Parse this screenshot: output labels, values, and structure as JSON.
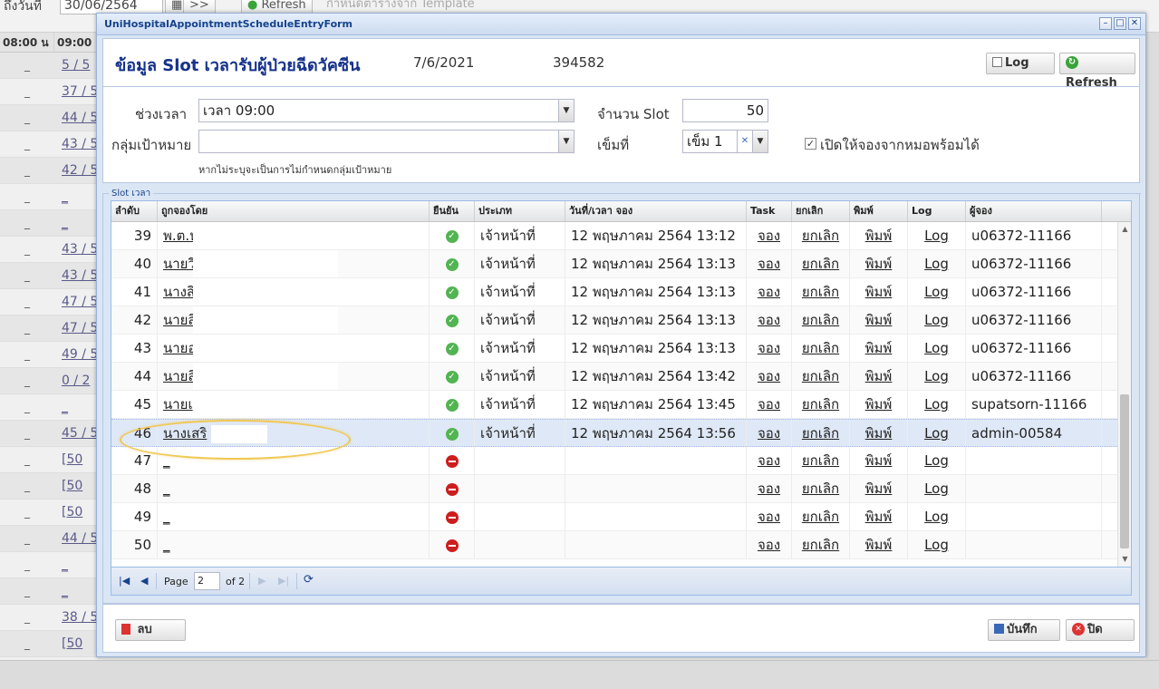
{
  "background": {
    "date_label": "ถึงวันที่",
    "date_value": "30/06/2564",
    "nav_btn": ">>",
    "refresh_btn": "Refresh",
    "template_btn": "กำหนดตารางจาก Template",
    "col_headers": [
      "08:00 น",
      "09:00"
    ],
    "rows": [
      {
        "c1": "_",
        "c2": "5 / 5"
      },
      {
        "c1": "_",
        "c2": "37 / 5"
      },
      {
        "c1": "_",
        "c2": "44 / 5"
      },
      {
        "c1": "_",
        "c2": "43 / 5"
      },
      {
        "c1": "_",
        "c2": "42 / 5"
      },
      {
        "c1": "_",
        "c2": "_"
      },
      {
        "c1": "_",
        "c2": "_"
      },
      {
        "c1": "_",
        "c2": "43 / 5"
      },
      {
        "c1": "_",
        "c2": "43 / 5"
      },
      {
        "c1": "_",
        "c2": "47 / 5"
      },
      {
        "c1": "_",
        "c2": "47 / 5"
      },
      {
        "c1": "_",
        "c2": "49 / 5"
      },
      {
        "c1": "_",
        "c2": "0 / 2"
      },
      {
        "c1": "_",
        "c2": "_"
      },
      {
        "c1": "_",
        "c2": "45 / 5"
      },
      {
        "c1": "_",
        "c2": "[50"
      },
      {
        "c1": "_",
        "c2": "[50"
      },
      {
        "c1": "_",
        "c2": "[50"
      },
      {
        "c1": "_",
        "c2": "44 / 5"
      },
      {
        "c1": "_",
        "c2": "_"
      },
      {
        "c1": "_",
        "c2": "_"
      },
      {
        "c1": "_",
        "c2": "38 / 5"
      },
      {
        "c1": "_",
        "c2": "[50"
      }
    ]
  },
  "window": {
    "title": "UniHospitalAppointmentScheduleEntryForm",
    "heading": "ข้อมูล Slot เวลารับผู้ป่วยฉีดวัคซีน",
    "date": "7/6/2021",
    "code": "394582",
    "log_btn": "Log",
    "refresh_btn": "Refresh"
  },
  "form": {
    "time_label": "ช่วงเวลา",
    "time_value": "เวลา 09:00",
    "group_label": "กลุ่มเป้าหมาย",
    "group_value": "",
    "hint": "หากไม่ระบุจะเป็นการไม่กำหนดกลุ่มเป้าหมาย",
    "slot_label": "จำนวน Slot",
    "slot_value": "50",
    "dose_label": "เข็มที่",
    "dose_value": "เข็ม 1",
    "doctor_checkbox_label": "เปิดให้จองจากหมอพร้อมได้",
    "doctor_checked": true
  },
  "grid": {
    "legend": "Slot เวลา",
    "headers": [
      "ลำดับ",
      "ถูกจองโดย",
      "ยืนยัน",
      "ประเภท",
      "วันที่/เวลา จอง",
      "Task",
      "ยกเลิก",
      "พิมพ์",
      "Log",
      "ผู้จอง"
    ],
    "rows": [
      {
        "no": "39",
        "name": "พ.ต.ห",
        "confirmed": true,
        "type": "เจ้าหน้าที่",
        "datetime": "12 พฤษภาคม 2564 13:12",
        "task": "จอง",
        "cancel": "ยกเลิก",
        "print": "พิมพ์",
        "log": "Log",
        "user": "u06372-11166"
      },
      {
        "no": "40",
        "name": "นายวี",
        "confirmed": true,
        "type": "เจ้าหน้าที่",
        "datetime": "12 พฤษภาคม 2564 13:13",
        "task": "จอง",
        "cancel": "ยกเลิก",
        "print": "พิมพ์",
        "log": "Log",
        "user": "u06372-11166"
      },
      {
        "no": "41",
        "name": "นางสิ",
        "confirmed": true,
        "type": "เจ้าหน้าที่",
        "datetime": "12 พฤษภาคม 2564 13:13",
        "task": "จอง",
        "cancel": "ยกเลิก",
        "print": "พิมพ์",
        "log": "Log",
        "user": "u06372-11166"
      },
      {
        "no": "42",
        "name": "นายสิ",
        "confirmed": true,
        "type": "เจ้าหน้าที่",
        "datetime": "12 พฤษภาคม 2564 13:13",
        "task": "จอง",
        "cancel": "ยกเลิก",
        "print": "พิมพ์",
        "log": "Log",
        "user": "u06372-11166"
      },
      {
        "no": "43",
        "name": "นายอ",
        "confirmed": true,
        "type": "เจ้าหน้าที่",
        "datetime": "12 พฤษภาคม 2564 13:13",
        "task": "จอง",
        "cancel": "ยกเลิก",
        "print": "พิมพ์",
        "log": "Log",
        "user": "u06372-11166"
      },
      {
        "no": "44",
        "name": "นายสิ",
        "confirmed": true,
        "type": "เจ้าหน้าที่",
        "datetime": "12 พฤษภาคม 2564 13:42",
        "task": "จอง",
        "cancel": "ยกเลิก",
        "print": "พิมพ์",
        "log": "Log",
        "user": "u06372-11166"
      },
      {
        "no": "45",
        "name": "นายเ",
        "confirmed": true,
        "type": "เจ้าหน้าที่",
        "datetime": "12 พฤษภาคม 2564 13:45",
        "task": "จอง",
        "cancel": "ยกเลิก",
        "print": "พิมพ์",
        "log": "Log",
        "user": "supatsorn-11166"
      },
      {
        "no": "46",
        "name": "นางเสริ",
        "confirmed": true,
        "type": "เจ้าหน้าที่",
        "datetime": "12 พฤษภาคม 2564 13:56",
        "task": "จอง",
        "cancel": "ยกเลิก",
        "print": "พิมพ์",
        "log": "Log",
        "user": "admin-00584"
      },
      {
        "no": "47",
        "name": "_",
        "confirmed": false,
        "type": "",
        "datetime": "",
        "task": "จอง",
        "cancel": "ยกเลิก",
        "print": "พิมพ์",
        "log": "Log",
        "user": ""
      },
      {
        "no": "48",
        "name": "_",
        "confirmed": false,
        "type": "",
        "datetime": "",
        "task": "จอง",
        "cancel": "ยกเลิก",
        "print": "พิมพ์",
        "log": "Log",
        "user": ""
      },
      {
        "no": "49",
        "name": "_",
        "confirmed": false,
        "type": "",
        "datetime": "",
        "task": "จอง",
        "cancel": "ยกเลิก",
        "print": "พิมพ์",
        "log": "Log",
        "user": ""
      },
      {
        "no": "50",
        "name": "_",
        "confirmed": false,
        "type": "",
        "datetime": "",
        "task": "จอง",
        "cancel": "ยกเลิก",
        "print": "พิมพ์",
        "log": "Log",
        "user": ""
      }
    ],
    "selected_row": "46"
  },
  "pager": {
    "page_label": "Page",
    "page_value": "2",
    "of_label": "of 2"
  },
  "footer": {
    "delete_btn": "ลบ",
    "save_btn": "บันทึก",
    "close_btn": "ปิด"
  },
  "colors": {
    "accent": "#15318b",
    "confirmed": "#52b452",
    "unconfirmed": "#cc1e1e",
    "highlight": "#f0c854"
  }
}
